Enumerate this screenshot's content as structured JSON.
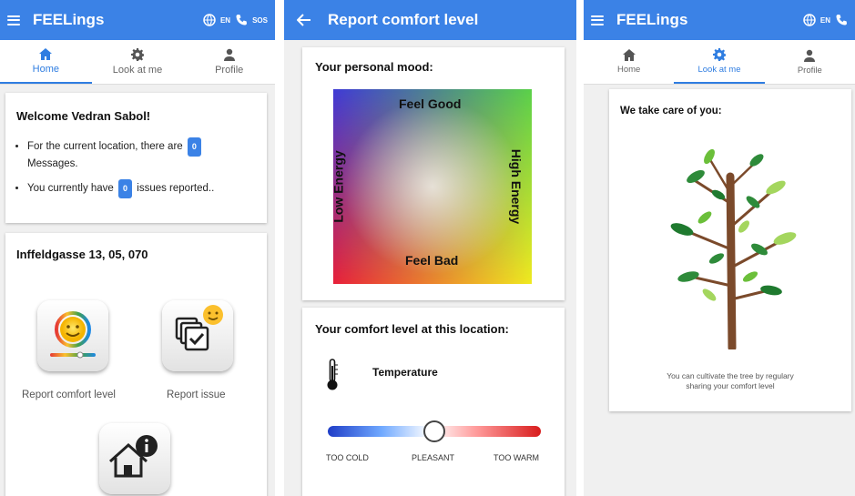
{
  "brand": {
    "primary": "#3b82e6"
  },
  "screen1": {
    "title": "FEELings",
    "lang": "EN",
    "sos": "SOS",
    "tabs": [
      {
        "label": "Home",
        "icon": "home-icon",
        "active": true
      },
      {
        "label": "Look at me",
        "icon": "gear-icon",
        "active": false
      },
      {
        "label": "Profile",
        "icon": "person-icon",
        "active": false
      }
    ],
    "welcome": "Welcome Vedran Sabol!",
    "msg1_pre": "For the current location, there are",
    "msg1_count": "0",
    "msg1_post": "Messages.",
    "msg2_pre": "You currently have",
    "msg2_count": "0",
    "msg2_post": "issues reported..",
    "location": "Inffeldgasse 13, 05, 070",
    "apps": [
      {
        "label": "Report comfort level",
        "icon": "mood-icon"
      },
      {
        "label": "Report issue",
        "icon": "issue-icon"
      },
      {
        "label": "",
        "icon": "house-info-icon"
      }
    ]
  },
  "screen2": {
    "title": "Report comfort level",
    "mood_title": "Your personal mood:",
    "feel_good": "Feel Good",
    "feel_bad": "Feel Bad",
    "low_energy": "Low Energy",
    "high_energy": "High Energy",
    "comfort_title": "Your comfort level at this location:",
    "temperature_label": "Temperature",
    "too_cold": "TOO COLD",
    "pleasant": "PLEASANT",
    "too_warm": "TOO WARM",
    "temperature_slider_value": 0.5
  },
  "screen3": {
    "title": "FEELings",
    "lang": "EN",
    "tabs": [
      {
        "label": "Home",
        "icon": "home-icon",
        "active": false
      },
      {
        "label": "Look at me",
        "icon": "gear-icon",
        "active": true
      },
      {
        "label": "Profile",
        "icon": "person-icon",
        "active": false
      }
    ],
    "care_title": "We take care of you:",
    "caption_line1": "You can cultivate the tree by regulary",
    "caption_line2": "sharing your comfort level"
  }
}
